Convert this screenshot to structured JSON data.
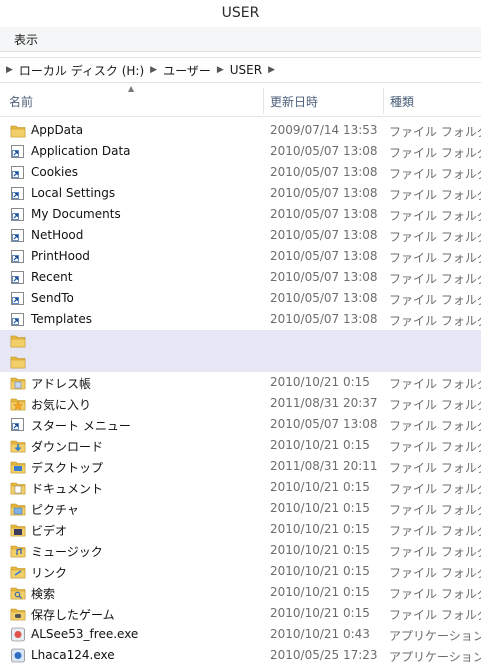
{
  "window": {
    "title": "USER"
  },
  "menu": {
    "view_label": "表示"
  },
  "address": {
    "segments": [
      "ローカル ディスク (H:)",
      "ユーザー",
      "USER"
    ]
  },
  "columns": {
    "name": "名前",
    "date": "更新日時",
    "type": "種類"
  },
  "colors": {
    "folder": "#e8b93c",
    "selection": "#e6e6f5",
    "header_text": "#4c607a"
  },
  "rows": [
    {
      "name": "AppData",
      "date": "2009/07/14 13:53",
      "type": "ファイル フォルダー",
      "icon": "folder-icon"
    },
    {
      "name": "Application Data",
      "date": "2010/05/07 13:08",
      "type": "ファイル フォルダー",
      "icon": "shortcut-icon"
    },
    {
      "name": "Cookies",
      "date": "2010/05/07 13:08",
      "type": "ファイル フォルダー",
      "icon": "shortcut-icon"
    },
    {
      "name": "Local Settings",
      "date": "2010/05/07 13:08",
      "type": "ファイル フォルダー",
      "icon": "shortcut-icon"
    },
    {
      "name": "My Documents",
      "date": "2010/05/07 13:08",
      "type": "ファイル フォルダー",
      "icon": "shortcut-icon"
    },
    {
      "name": "NetHood",
      "date": "2010/05/07 13:08",
      "type": "ファイル フォルダー",
      "icon": "shortcut-icon"
    },
    {
      "name": "PrintHood",
      "date": "2010/05/07 13:08",
      "type": "ファイル フォルダー",
      "icon": "shortcut-icon"
    },
    {
      "name": "Recent",
      "date": "2010/05/07 13:08",
      "type": "ファイル フォルダー",
      "icon": "shortcut-icon"
    },
    {
      "name": "SendTo",
      "date": "2010/05/07 13:08",
      "type": "ファイル フォルダー",
      "icon": "shortcut-icon"
    },
    {
      "name": "Templates",
      "date": "2010/05/07 13:08",
      "type": "ファイル フォルダー",
      "icon": "shortcut-icon"
    },
    {
      "name": "",
      "date": "",
      "type": "",
      "icon": "folder-icon",
      "selected": true
    },
    {
      "name": "",
      "date": "",
      "type": "",
      "icon": "folder-icon",
      "selected": true
    },
    {
      "name": "アドレス帳",
      "date": "2010/10/21 0:15",
      "type": "ファイル フォルダー",
      "icon": "contacts-folder-icon"
    },
    {
      "name": "お気に入り",
      "date": "2011/08/31 20:37",
      "type": "ファイル フォルダー",
      "icon": "favorites-folder-icon"
    },
    {
      "name": "スタート メニュー",
      "date": "2010/05/07 13:08",
      "type": "ファイル フォルダー",
      "icon": "shortcut-icon"
    },
    {
      "name": "ダウンロード",
      "date": "2010/10/21 0:15",
      "type": "ファイル フォルダー",
      "icon": "downloads-folder-icon"
    },
    {
      "name": "デスクトップ",
      "date": "2011/08/31 20:11",
      "type": "ファイル フォルダー",
      "icon": "desktop-folder-icon"
    },
    {
      "name": "ドキュメント",
      "date": "2010/10/21 0:15",
      "type": "ファイル フォルダー",
      "icon": "documents-folder-icon"
    },
    {
      "name": "ピクチャ",
      "date": "2010/10/21 0:15",
      "type": "ファイル フォルダー",
      "icon": "pictures-folder-icon"
    },
    {
      "name": "ビデオ",
      "date": "2010/10/21 0:15",
      "type": "ファイル フォルダー",
      "icon": "videos-folder-icon"
    },
    {
      "name": "ミュージック",
      "date": "2010/10/21 0:15",
      "type": "ファイル フォルダー",
      "icon": "music-folder-icon"
    },
    {
      "name": "リンク",
      "date": "2010/10/21 0:15",
      "type": "ファイル フォルダー",
      "icon": "links-folder-icon"
    },
    {
      "name": "検索",
      "date": "2010/10/21 0:15",
      "type": "ファイル フォルダー",
      "icon": "search-folder-icon"
    },
    {
      "name": "保存したゲーム",
      "date": "2010/10/21 0:15",
      "type": "ファイル フォルダー",
      "icon": "saved-games-folder-icon"
    },
    {
      "name": "ALSee53_free.exe",
      "date": "2010/10/21 0:43",
      "type": "アプリケーション",
      "icon": "alsee-app-icon"
    },
    {
      "name": "Lhaca124.exe",
      "date": "2010/05/25 17:23",
      "type": "アプリケーション",
      "icon": "lhaca-app-icon"
    }
  ]
}
